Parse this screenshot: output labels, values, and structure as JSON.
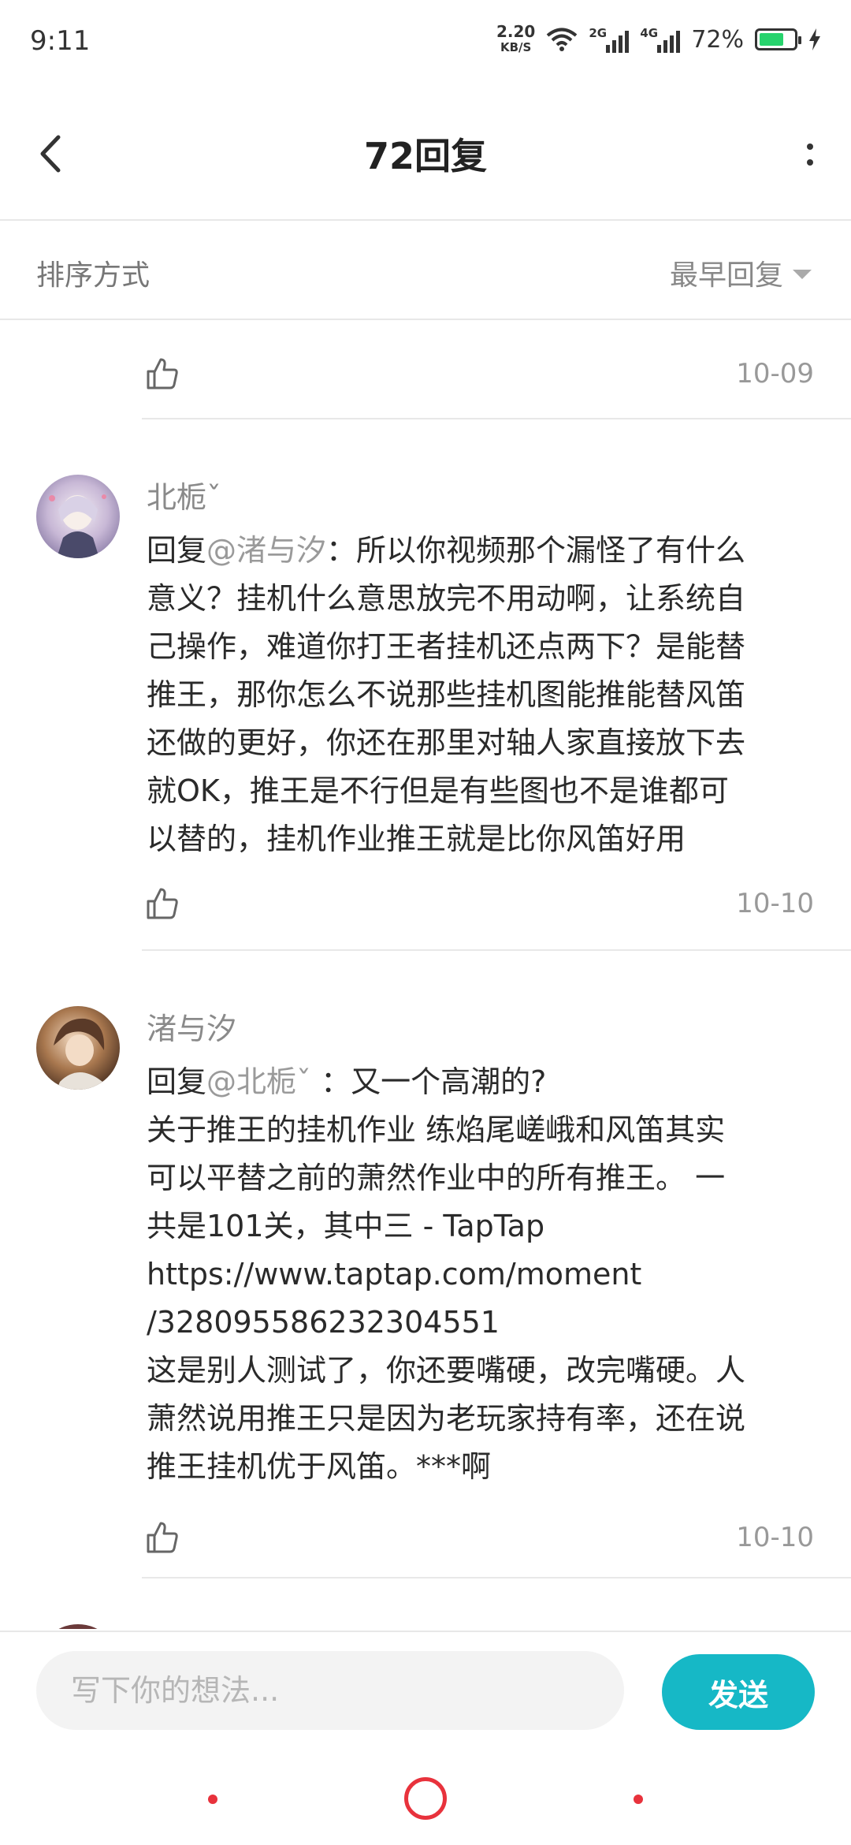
{
  "status_bar": {
    "time": "9:11",
    "net_speed": "2.20",
    "net_unit": "KB/S",
    "sim1_tag": "2G",
    "sim2_tag": "4G",
    "battery_percent": "72%",
    "battery_level": 0.72,
    "icons": [
      "wifi-icon",
      "signal-icon",
      "battery-icon",
      "charging-icon"
    ]
  },
  "header": {
    "title": "72回复",
    "back_icon": "chevron-left-icon",
    "more_icon": "more-vertical-icon"
  },
  "sort": {
    "label": "排序方式",
    "selected": "最早回复"
  },
  "replies": [
    {
      "date": "10-09"
    },
    {
      "author": "北栀ˇ",
      "prefix": "回复",
      "mention": "@渚与汐",
      "lines": [
        "：所以你视频那个漏怪了有什么",
        "意义？挂机什么意思放完不用动啊，让系统自",
        "己操作，难道你打王者挂机还点两下？是能替",
        "推王，那你怎么不说那些挂机图能推能替风笛",
        "还做的更好，你还在那里对轴人家直接放下去",
        "就OK，推王是不行但是有些图也不是谁都可",
        "以替的，挂机作业推王就是比你风笛好用"
      ],
      "date": "10-10"
    },
    {
      "author": "渚与汐",
      "prefix": "回复",
      "mention": "@北栀ˇ",
      "lines": [
        " ：又一个高潮的?",
        "关于推王的挂机作业 练焰尾嵯峨和风笛其实",
        "可以平替之前的萧然作业中的所有推王。 一",
        "共是101关，其中三 - TapTap",
        "https://www.taptap.com/moment",
        "/328095586232304551",
        "这是别人测试了，你还要嘴硬，改完嘴硬。人",
        "萧然说用推王只是因为老玩家持有率，还在说",
        "推王挂机优于风笛。***啊"
      ],
      "date": "10-10"
    }
  ],
  "composer": {
    "placeholder": "写下你的想法...",
    "send_label": "发送"
  },
  "colors": {
    "accent": "#16b8c6",
    "nav": "#e8323c",
    "battery": "#27d36d"
  }
}
